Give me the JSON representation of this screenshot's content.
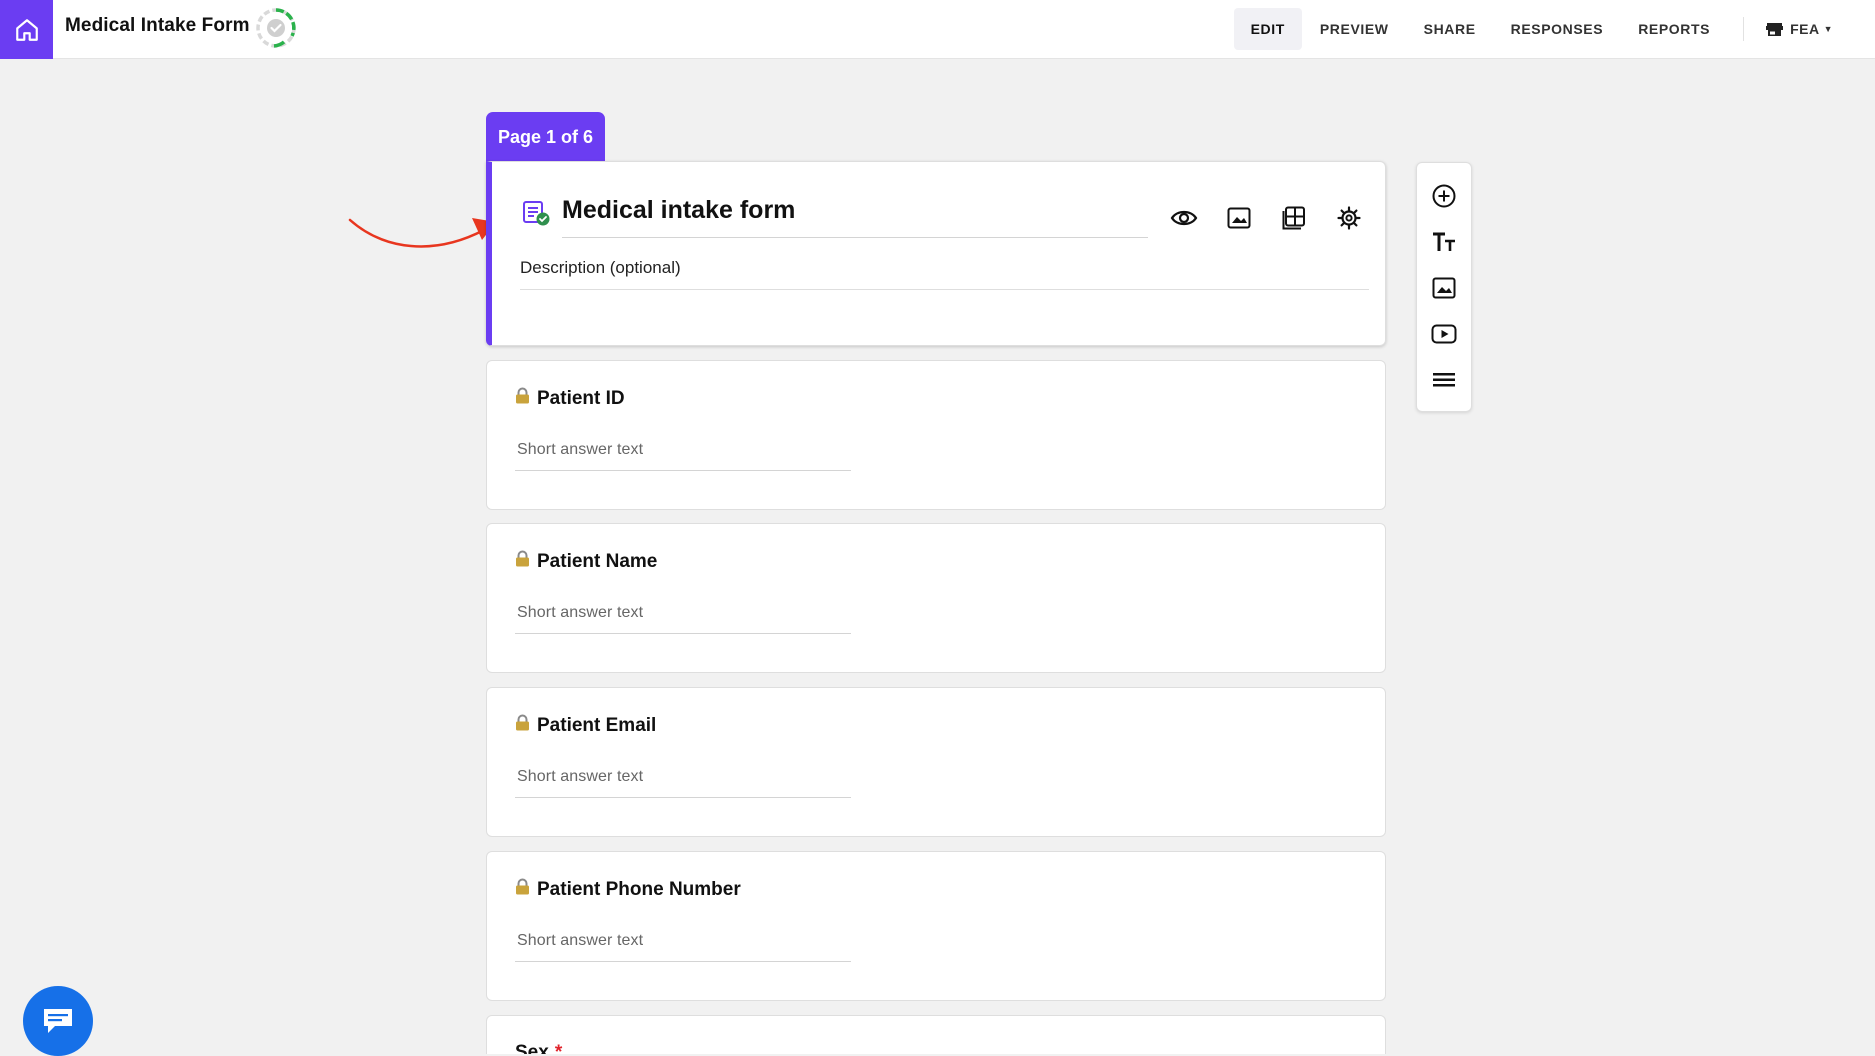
{
  "app": {
    "title": "Medical Intake Form"
  },
  "nav": {
    "items": [
      {
        "label": "EDIT",
        "active": true
      },
      {
        "label": "PREVIEW",
        "active": false
      },
      {
        "label": "SHARE",
        "active": false
      },
      {
        "label": "RESPONSES",
        "active": false
      },
      {
        "label": "REPORTS",
        "active": false
      }
    ],
    "workspace": "FEA"
  },
  "page_tab": "Page 1 of 6",
  "form": {
    "title": "Medical intake form",
    "description_placeholder": "Description (optional)"
  },
  "questions": [
    {
      "title": "Patient ID",
      "placeholder": "Short answer text",
      "locked": true
    },
    {
      "title": "Patient Name",
      "placeholder": "Short answer text",
      "locked": true
    },
    {
      "title": "Patient Email",
      "placeholder": "Short answer text",
      "locked": true
    },
    {
      "title": "Patient Phone Number",
      "placeholder": "Short answer text",
      "locked": true
    },
    {
      "title": "Sex",
      "required_mark": "*"
    }
  ],
  "icons": {
    "home": "home-icon",
    "status": "saved-status-icon",
    "form": "form-icon",
    "preview": "eye-icon",
    "image": "image-icon",
    "layout": "layout-icon",
    "settings": "gear-icon",
    "add": "add-circle-icon",
    "text": "text-icon",
    "video": "video-icon",
    "section": "section-icon",
    "chat": "chat-icon"
  },
  "colors": {
    "brand": "#6b3df2",
    "required": "#e0232b",
    "chat": "#1670e8",
    "status_ring": "#2bb24c"
  }
}
